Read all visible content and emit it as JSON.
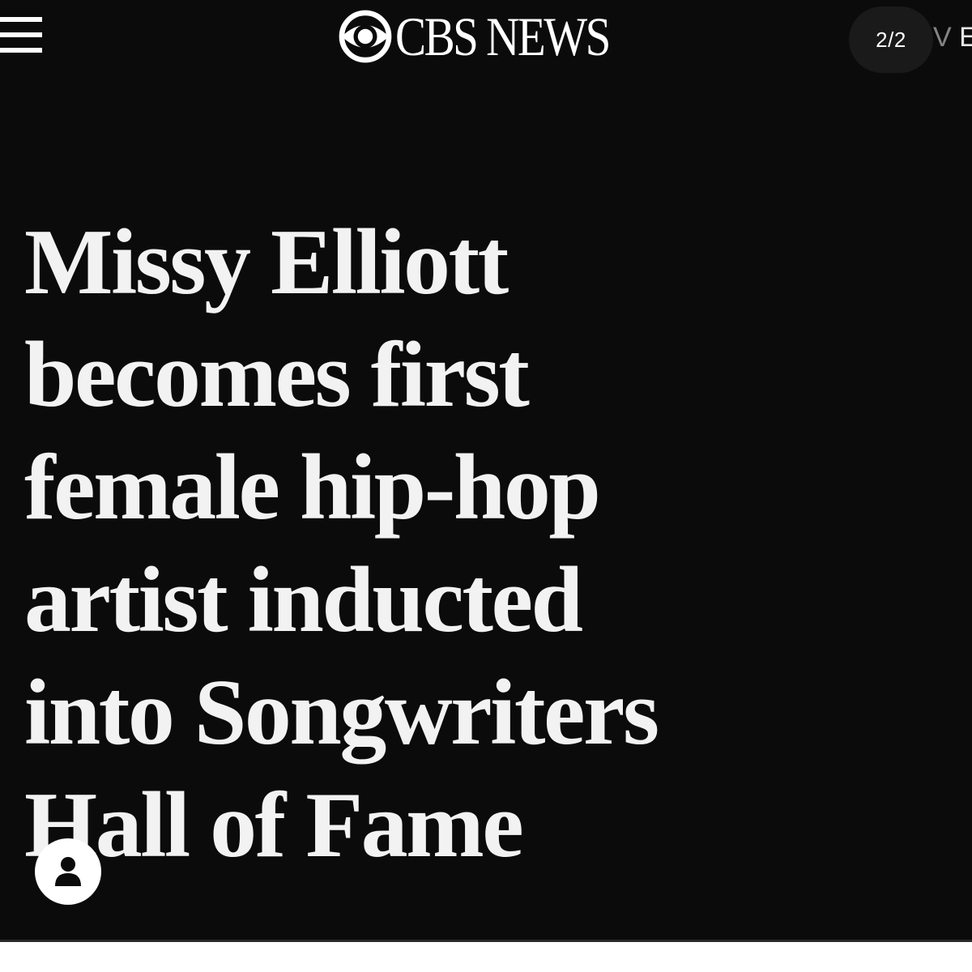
{
  "header": {
    "logo_text": "CBS NEWS",
    "logo_icon": "cbs-eye-icon",
    "menu_icon": "hamburger-menu-icon",
    "image_counter": "2/2",
    "live_fragment_v": "V",
    "live_fragment_e": "E"
  },
  "article": {
    "headline_lines": [
      "Missy Elliott",
      "becomes first",
      "female hip-hop",
      "artist inducted",
      "into Songwriters",
      "Hall of Fame"
    ]
  },
  "account": {
    "icon": "user-account-icon"
  },
  "colors": {
    "background": "#0b0b0b",
    "text": "#f2f2f2",
    "pill": "#1a1a1a"
  }
}
